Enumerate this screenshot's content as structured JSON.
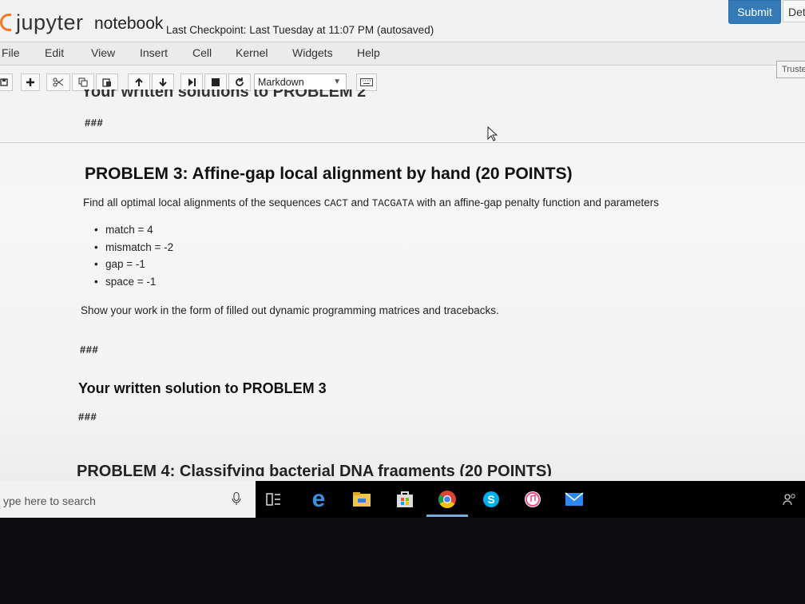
{
  "header": {
    "logo_text": "jupyter",
    "notebook_name": "notebook",
    "checkpoint": "Last Checkpoint: Last Tuesday at 11:07 PM (autosaved)",
    "submit_label": "Submit",
    "det_label": "Det"
  },
  "menubar": {
    "items": [
      "File",
      "Edit",
      "View",
      "Insert",
      "Cell",
      "Kernel",
      "Widgets",
      "Help"
    ],
    "trusted_label": "Truste"
  },
  "toolbar": {
    "cell_type": "Markdown",
    "icons": [
      "save-icon",
      "plus-icon",
      "cut-icon",
      "copy-icon",
      "paste-icon",
      "arrow-up-icon",
      "arrow-down-icon",
      "run-icon",
      "stop-icon",
      "restart-icon",
      "keyboard-icon"
    ]
  },
  "notebook": {
    "clipped_heading": "Your written solutions to PROBLEM 2",
    "hash1": "###",
    "problem_title": "PROBLEM 3: Affine-gap local alignment by hand (20 POINTS)",
    "intro_prefix": "Find all optimal local alignments of the sequences",
    "seq1": "CACT",
    "intro_and": "and",
    "seq2": "TACGATA",
    "intro_suffix": "with an affine-gap penalty function and parameters",
    "bullets": [
      "match = 4",
      "mismatch = -2",
      "gap = -1",
      "space = -1"
    ],
    "show_work": "Show your work in the form of filled out dynamic programming matrices and tracebacks.",
    "hash2": "###",
    "written_solution": "Your written solution to PROBLEM 3",
    "hash3": "###",
    "problem4_title": "PROBLEM 4: Classifying bacterial DNA fragments (20 POINTS)"
  },
  "taskbar": {
    "search_placeholder": "ype here to search",
    "apps": [
      "task-view-icon",
      "edge-icon",
      "file-explorer-icon",
      "store-icon",
      "chrome-icon",
      "skype-icon",
      "itunes-icon",
      "mail-icon",
      "people-icon"
    ]
  }
}
